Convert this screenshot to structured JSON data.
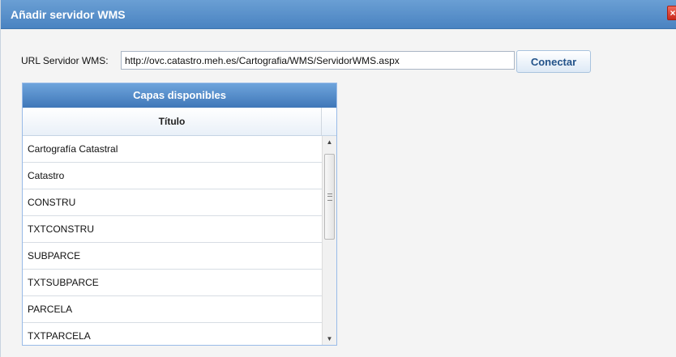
{
  "dialog": {
    "title": "Añadir servidor WMS",
    "close_icon": "×"
  },
  "form": {
    "url_label": "URL Servidor WMS:",
    "url_value": "http://ovc.catastro.meh.es/Cartografia/WMS/ServidorWMS.aspx",
    "connect_label": "Conectar"
  },
  "grid": {
    "header": "Capas disponibles",
    "column_title": "Título",
    "rows": [
      "Cartografía Catastral",
      "Catastro",
      "CONSTRU",
      "TXTCONSTRU",
      "SUBPARCE",
      "TXTSUBPARCE",
      "PARCELA",
      "TXTPARCELA"
    ],
    "scroll_up_icon": "▲",
    "scroll_down_icon": "▼"
  },
  "colors": {
    "title_bar": "#4a83c1",
    "grid_header": "#3f77b8",
    "connect_text": "#23538a",
    "close": "#c7271a"
  }
}
